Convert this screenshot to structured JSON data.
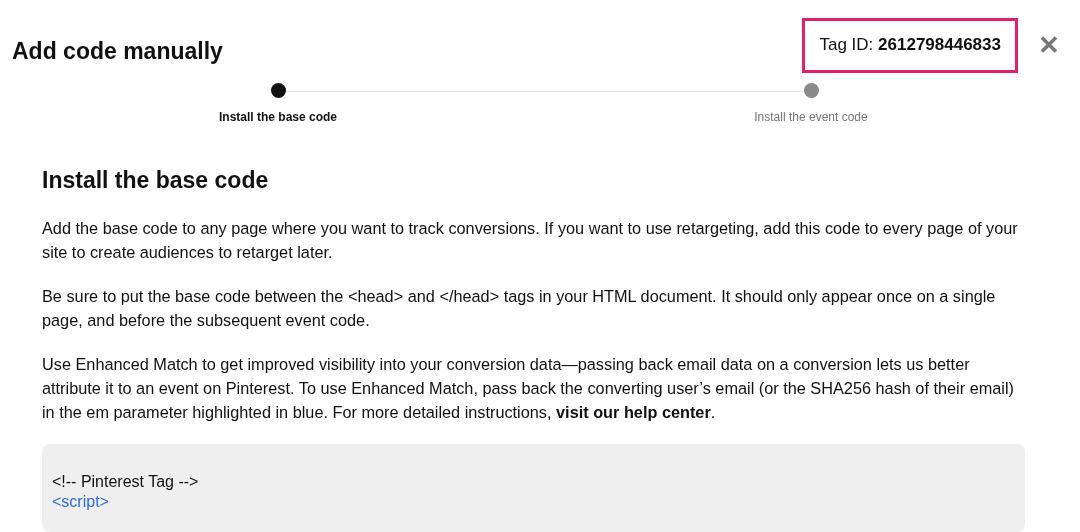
{
  "title": "Add code manually",
  "tag_id": {
    "label": "Tag ID:",
    "value": "2612798446833",
    "highlighted": true
  },
  "close": "✕",
  "steps": [
    {
      "label": "Install the base code",
      "selected": true
    },
    {
      "label": "Install the event code",
      "selected": false
    }
  ],
  "section": {
    "heading": "Install the base code",
    "paragraphs": [
      {
        "text": "Add the base code to any page where you want to track conversions. If you want to use retargeting, add this code to every page of your site to create audiences to retarget later."
      },
      {
        "text": "Be sure to put the base code between the <head> and </head> tags in your HTML document. It should only appear once on a single page, and before the subsequent event code."
      },
      {
        "text": "Use Enhanced Match to get improved visibility into your conversion data—passing back email data on a conversion lets us better attribute it to an event on Pinterest. To use Enhanced Match, pass back the converting user’s email (or the SHA256 hash of their email) in the em parameter highlighted in blue. For more detailed instructions, ",
        "link": "visit our help center",
        "after": "."
      }
    ],
    "code_lines": [
      {
        "text": "<!-- Pinterest Tag -->",
        "kind": "comment"
      },
      {
        "text": "<script>",
        "kind": "tag"
      }
    ]
  }
}
